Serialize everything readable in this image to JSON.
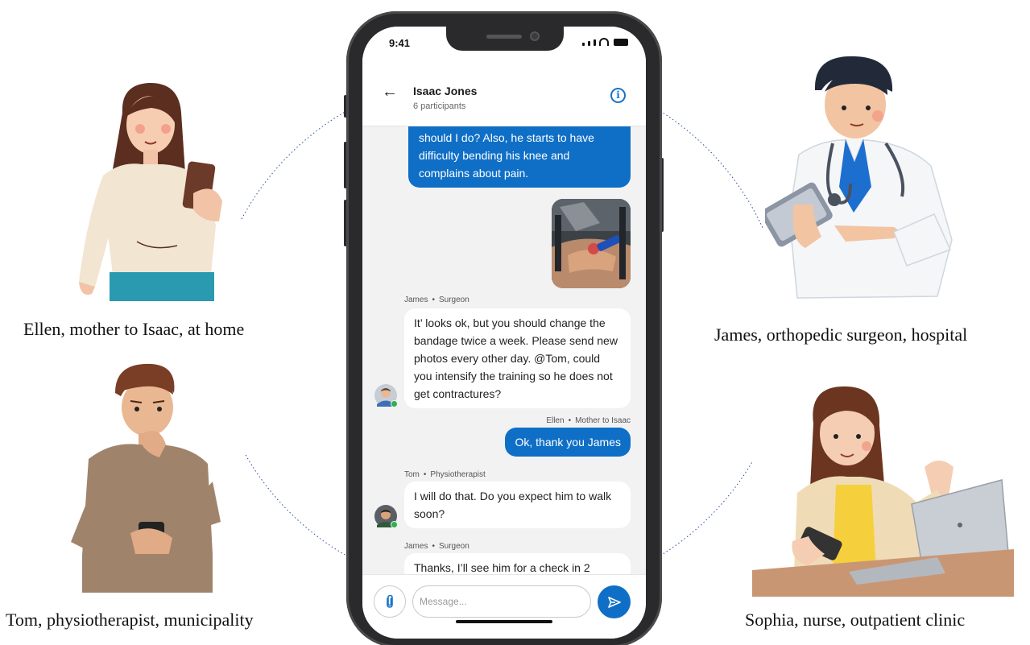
{
  "captions": {
    "ellen": "Ellen, mother to Isaac, at home",
    "tom": "Tom, physiotherapist, municipality",
    "james": "James, orthopedic surgeon, hospital",
    "sophia": "Sophia, nurse, outpatient clinic"
  },
  "phone": {
    "status_time": "9:41",
    "header": {
      "back_icon": "arrow-left-icon",
      "title": "Isaac Jones",
      "subtitle": "6 participants",
      "info_icon": "info-icon"
    },
    "messages": [
      {
        "direction": "outgoing",
        "text": "should I do? Also, he starts to have difficulty bending his knee and complains about pain."
      },
      {
        "direction": "outgoing",
        "type": "photo"
      },
      {
        "direction": "incoming",
        "sender": "James",
        "role": "Surgeon",
        "text": "It’ looks ok, but you should change the bandage twice a week. Please send new photos every other day. @Tom, could you intensify the training so he does not get contractures?"
      },
      {
        "direction": "outgoing",
        "sender": "Ellen",
        "role": "Mother to Isaac",
        "text": "Ok, thank you James"
      },
      {
        "direction": "incoming",
        "sender": "Tom",
        "role": "Physiotherapist",
        "text": "I will do that. Do you expect him to walk soon?"
      },
      {
        "direction": "incoming",
        "sender": "James",
        "role": "Surgeon",
        "text": "Thanks, I’ll see him for a check in 2"
      }
    ],
    "composer": {
      "attach_icon": "paperclip-icon",
      "placeholder": "Message...",
      "send_icon": "send-icon"
    }
  },
  "colors": {
    "accent": "#0f6fc6",
    "chat_background": "#f2f2f3",
    "online": "#2bb24c"
  }
}
